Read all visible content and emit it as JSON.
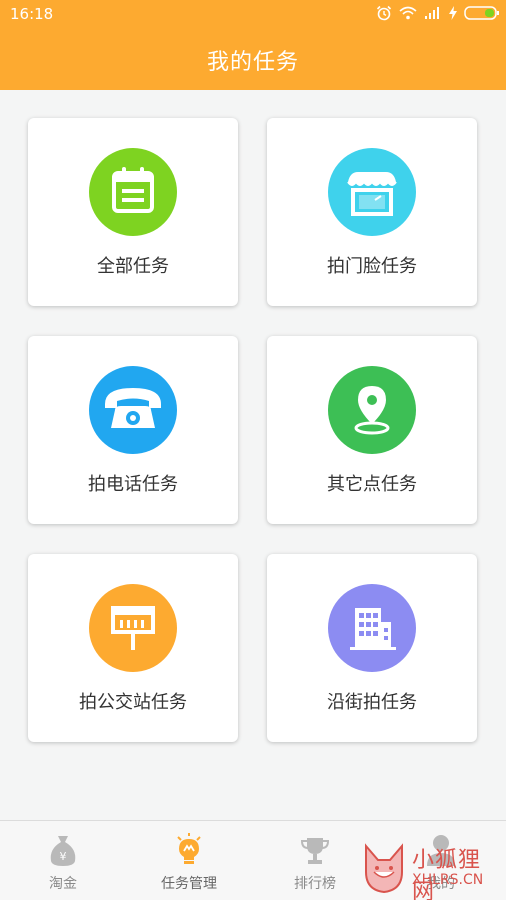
{
  "status_bar": {
    "time": "16:18"
  },
  "header": {
    "title": "我的任务"
  },
  "cards": [
    {
      "label": "全部任务",
      "icon": "calendar-icon",
      "color": "#7ed321"
    },
    {
      "label": "拍门脸任务",
      "icon": "storefront-icon",
      "color": "#3fd2ec"
    },
    {
      "label": "拍电话任务",
      "icon": "telephone-icon",
      "color": "#21a7f0"
    },
    {
      "label": "其它点任务",
      "icon": "map-pin-icon",
      "color": "#3dbf55"
    },
    {
      "label": "拍公交站任务",
      "icon": "bus-stop-icon",
      "color": "#fdaa30"
    },
    {
      "label": "沿街拍任务",
      "icon": "building-icon",
      "color": "#8c8cf2"
    }
  ],
  "tabbar": {
    "items": [
      {
        "label": "淘金",
        "icon": "money-bag-icon",
        "active": false
      },
      {
        "label": "任务管理",
        "icon": "lightbulb-icon",
        "active": true
      },
      {
        "label": "排行榜",
        "icon": "trophy-icon",
        "active": false
      },
      {
        "label": "我的",
        "icon": "person-icon",
        "active": false
      }
    ]
  },
  "watermark": {
    "line1": "小狐狸网",
    "line2": "XHLRS.CN"
  },
  "colors": {
    "accent": "#fdaa30",
    "background": "#f4f5f5"
  }
}
